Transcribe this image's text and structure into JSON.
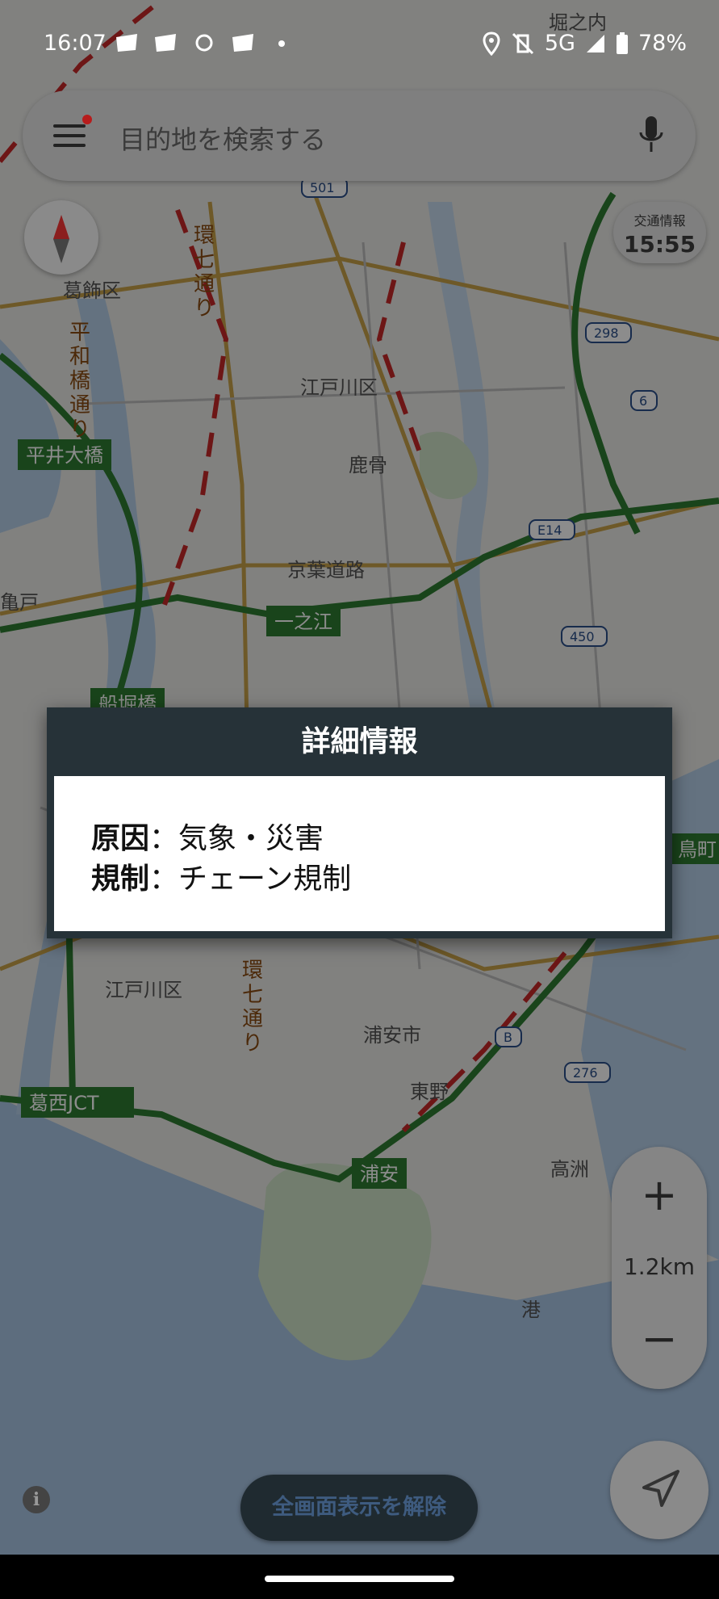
{
  "status_bar": {
    "time": "16:07",
    "network": "5G",
    "battery": "78%"
  },
  "search": {
    "placeholder": "目的地を検索する"
  },
  "traffic_info": {
    "label": "交通情報",
    "time": "15:55"
  },
  "map_labels": {
    "hori_no_uchi": "堀之内",
    "katsushika": "葛飾区",
    "kan7_top": "環七通り",
    "heiwabashi": "平和橋通り",
    "edogawa_top": "江戸川区",
    "hirai_ohashi": "平井大橋",
    "shikabone": "鹿骨",
    "keiyo": "京葉道路",
    "kameido": "亀戸",
    "ichinoe": "一之江",
    "funabori": "船堀橋",
    "edogawa_bottom": "江戸川区",
    "kan7_bottom": "環七通り",
    "kasai_jct": "葛西JCT",
    "urayasu_city": "浦安市",
    "higashino": "東野",
    "urayasu": "浦安",
    "takasu": "高洲",
    "minato": "港",
    "shinkiba": "鳥町",
    "r501": "501",
    "r298": "298",
    "r6": "6",
    "e14": "E14",
    "r450": "450",
    "rb": "B",
    "r276": "276"
  },
  "dialog": {
    "title": "詳細情報",
    "cause_label": "原因",
    "cause_value": "気象・災害",
    "regulation_label": "規制",
    "regulation_value": "チェーン規制",
    "separator": "："
  },
  "zoom": {
    "plus": "+",
    "scale": "1.2km",
    "minus": "−"
  },
  "exit_fullscreen_label": "全画面表示を解除",
  "colors": {
    "dialog_header": "#263238",
    "traffic_green": "#2e7d32",
    "traffic_red": "#c62828",
    "water": "#a9c6e6",
    "land": "#ecebe7"
  }
}
